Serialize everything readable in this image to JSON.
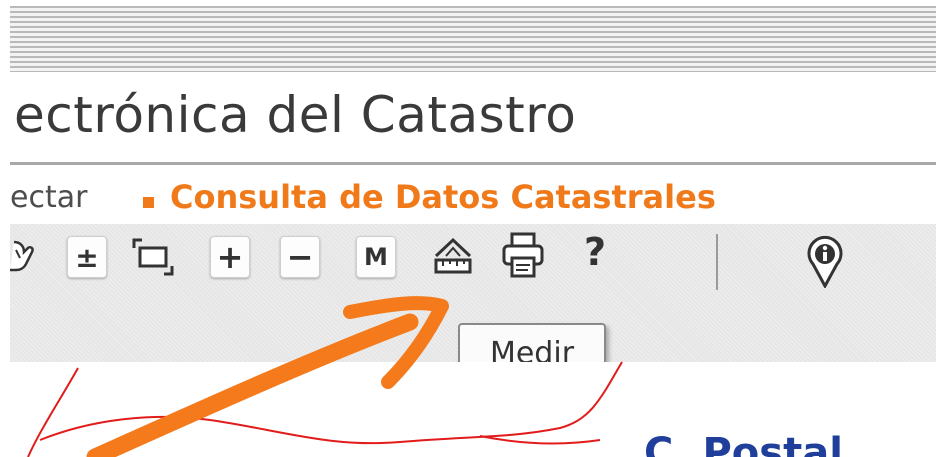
{
  "header": {
    "title": "ectrónica del Catastro"
  },
  "nav": {
    "left_item": "ectar",
    "active_item": "Consulta de Datos Catastrales"
  },
  "toolbar": {
    "items": [
      {
        "name": "pan-icon",
        "label": ""
      },
      {
        "name": "zoom-toggle-button",
        "label": "±"
      },
      {
        "name": "zoom-window-button",
        "label": ""
      },
      {
        "name": "zoom-in-button",
        "label": "+"
      },
      {
        "name": "zoom-out-button",
        "label": "−"
      },
      {
        "name": "m-button",
        "label": "M"
      },
      {
        "name": "measure-icon",
        "label": ""
      },
      {
        "name": "print-icon",
        "label": ""
      },
      {
        "name": "help-icon",
        "label": "?"
      },
      {
        "name": "info-icon",
        "label": ""
      }
    ]
  },
  "tooltip": {
    "text": "Medir"
  },
  "map": {
    "partial_link": "C. Postal"
  },
  "colors": {
    "accent": "#f07a1a",
    "link": "#1f3f9a",
    "annotation": "#f47a1c",
    "sketch": "#e21b1b"
  }
}
